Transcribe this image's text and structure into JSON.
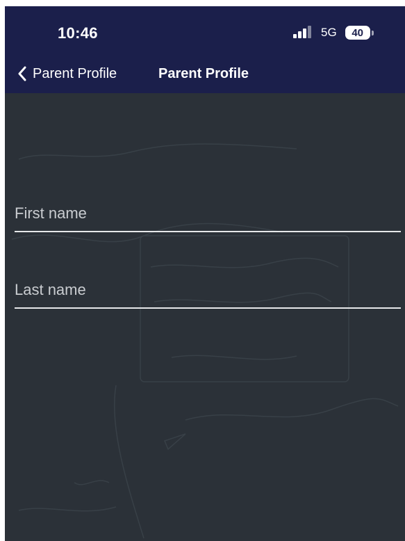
{
  "status_bar": {
    "time": "10:46",
    "network": "5G",
    "battery": "40"
  },
  "nav": {
    "back_label": "Parent Profile",
    "title": "Parent Profile"
  },
  "form": {
    "first_name": {
      "placeholder": "First name",
      "value": ""
    },
    "last_name": {
      "placeholder": "Last name",
      "value": ""
    }
  },
  "colors": {
    "header_bg": "#1b1f4b",
    "screen_bg": "#2b3138",
    "text": "#ffffff",
    "placeholder": "#c9ccd0",
    "field_underline": "#e6e8ea"
  },
  "icons": [
    "signal-bars-icon",
    "chevron-left-icon"
  ]
}
